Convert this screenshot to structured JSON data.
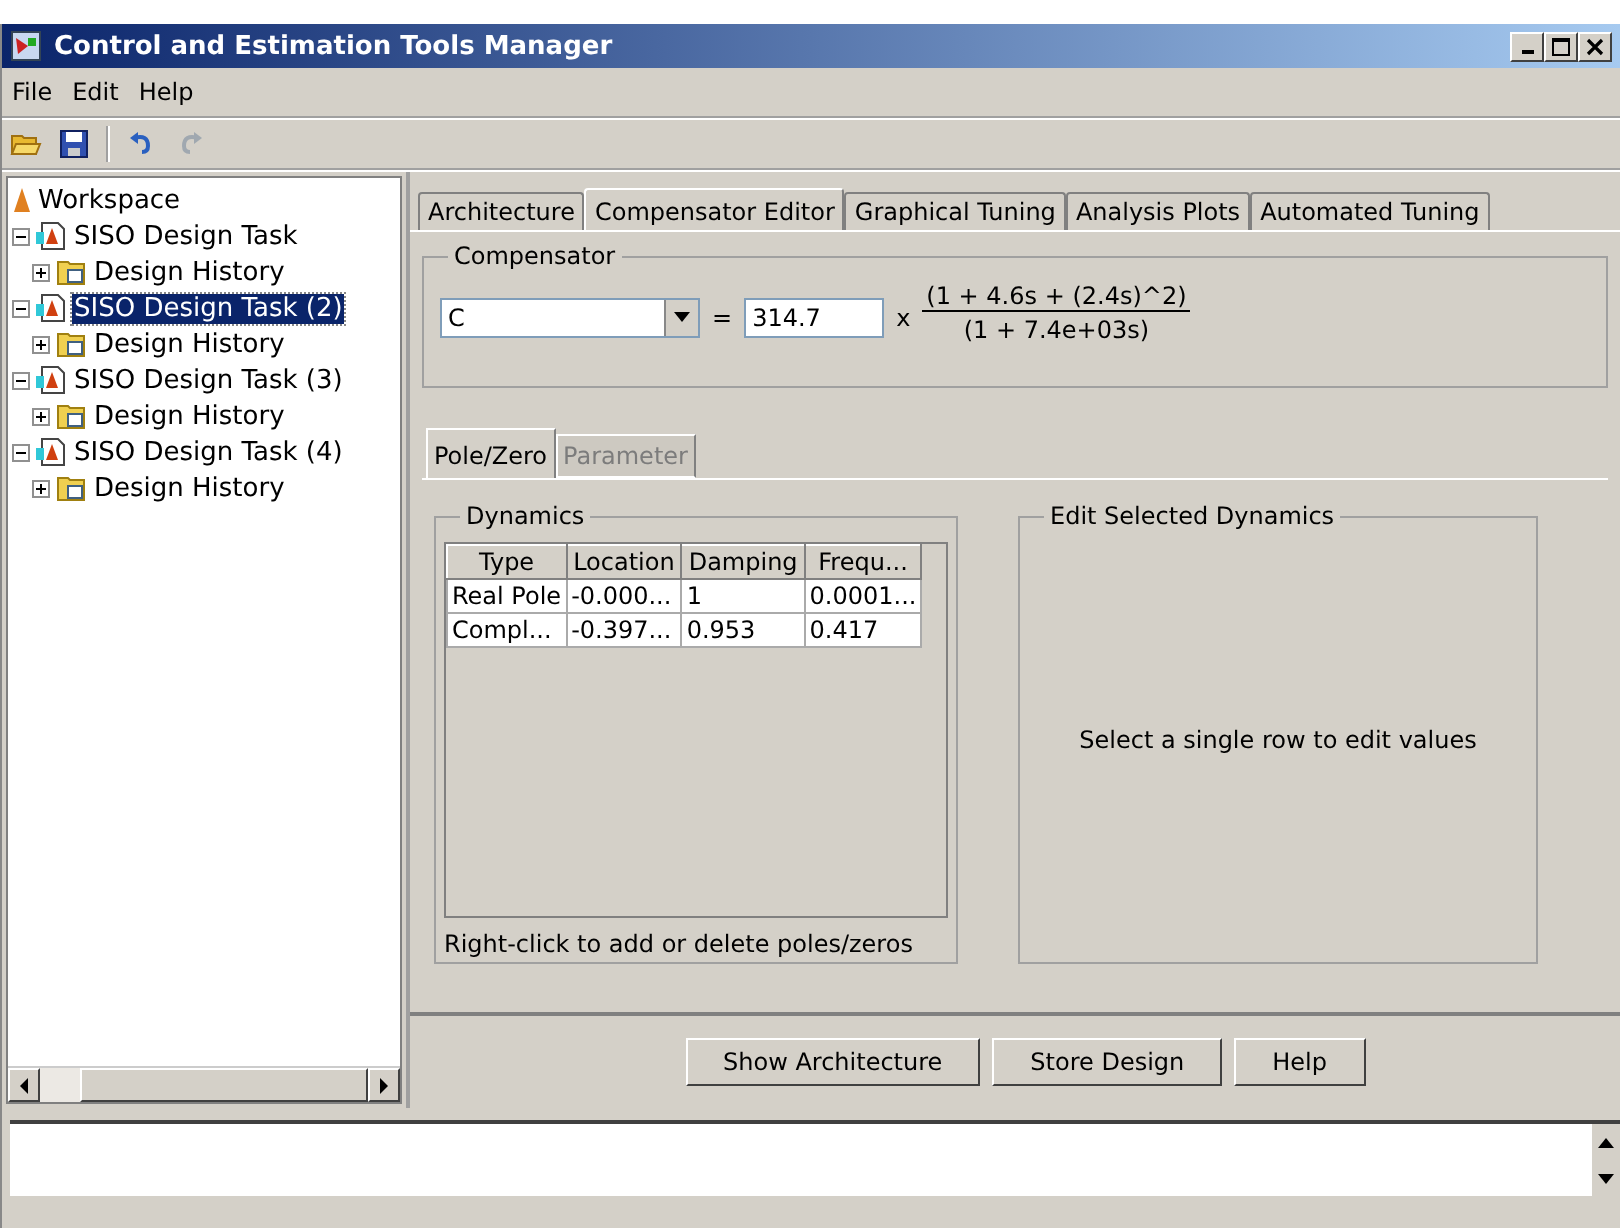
{
  "window": {
    "title": "Control and Estimation Tools Manager"
  },
  "menu": [
    {
      "label": "File"
    },
    {
      "label": "Edit"
    },
    {
      "label": "Help"
    }
  ],
  "toolbar": [
    {
      "kind": "open"
    },
    {
      "kind": "save"
    },
    {
      "kind": "separator"
    },
    {
      "kind": "undo",
      "disabled": false
    },
    {
      "kind": "redo",
      "disabled": true
    }
  ],
  "tree": {
    "label": "Workspace",
    "children": [
      {
        "label": "SISO Design Task",
        "selected": false,
        "expanded": true,
        "children": [
          {
            "label": "Design History",
            "selected": false,
            "expanded": false
          }
        ]
      },
      {
        "label": "SISO Design Task (2)",
        "selected": true,
        "expanded": true,
        "children": [
          {
            "label": "Design History",
            "selected": false,
            "expanded": false
          }
        ]
      },
      {
        "label": "SISO Design Task (3)",
        "selected": false,
        "expanded": true,
        "children": [
          {
            "label": "Design History",
            "selected": false,
            "expanded": false
          }
        ]
      },
      {
        "label": "SISO Design Task (4)",
        "selected": false,
        "expanded": true,
        "children": [
          {
            "label": "Design History",
            "selected": false,
            "expanded": false
          }
        ]
      }
    ]
  },
  "tabs": [
    {
      "label": "Architecture",
      "selected": false
    },
    {
      "label": "Compensator Editor",
      "selected": true
    },
    {
      "label": "Graphical Tuning",
      "selected": false
    },
    {
      "label": "Analysis Plots",
      "selected": false
    },
    {
      "label": "Automated Tuning",
      "selected": false
    }
  ],
  "compensator": {
    "title": "Compensator",
    "name": "C",
    "equals": "=",
    "gain": "314.7",
    "times": "x",
    "numerator": "(1 + 4.6s + (2.4s)^2)",
    "denominator": "(1 + 7.4e+03s)"
  },
  "subtabs": [
    {
      "label": "Pole/Zero",
      "selected": true,
      "disabled": false
    },
    {
      "label": "Parameter",
      "selected": false,
      "disabled": true
    }
  ],
  "dynamics": {
    "title": "Dynamics",
    "columns": [
      "Type",
      "Location",
      "Damping",
      "Frequ..."
    ],
    "rows": [
      [
        "Real Pole",
        "-0.000...",
        "1",
        "0.0001..."
      ],
      [
        "Compl...",
        "-0.397...",
        "0.953",
        "0.417"
      ]
    ],
    "hint": "Right-click to add or delete poles/zeros"
  },
  "edit_panel": {
    "title": "Edit Selected Dynamics",
    "message": "Select a single row to edit values"
  },
  "buttons": [
    "Show Architecture",
    "Store Design",
    "Help"
  ]
}
